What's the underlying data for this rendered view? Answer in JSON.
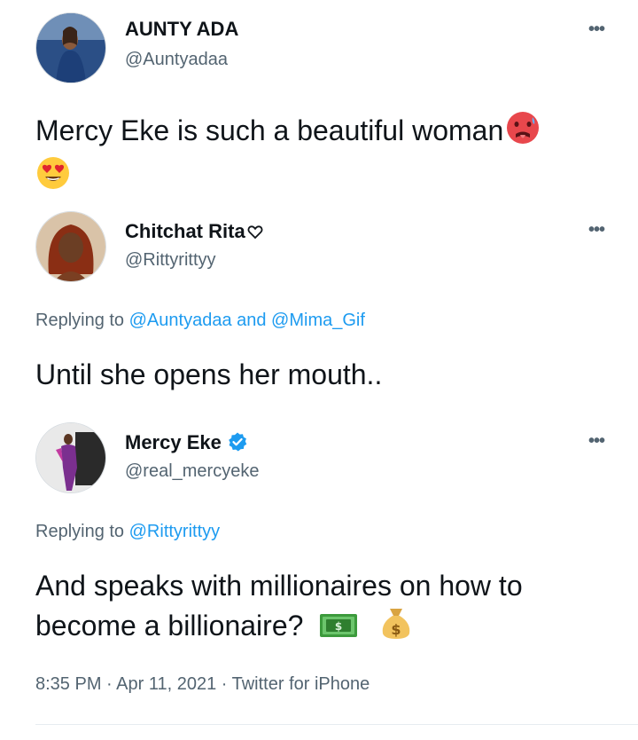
{
  "tweets": [
    {
      "name": "AUNTY ADA",
      "handle": "@Auntyadaa",
      "more": "•••",
      "text": "Mercy Eke is such a beautiful woman",
      "emojis": [
        "hot-face-emoji",
        "heart-eyes-emoji"
      ],
      "avatar_colors": [
        "#1a3a6b",
        "#3b6fae"
      ]
    },
    {
      "name": "Chitchat Rita",
      "handle": "@Rittyrittyy",
      "more": "•••",
      "reply_prefix": "Replying to ",
      "reply_mention_1": "@Auntyadaa",
      "reply_and": " and ",
      "reply_mention_2": "@Mima_Gif",
      "text": "Until she opens her mouth..",
      "avatar_colors": [
        "#5a2a18",
        "#b9562e"
      ]
    },
    {
      "name": "Mercy Eke",
      "handle": "@real_mercyeke",
      "more": "•••",
      "verified": true,
      "reply_prefix": "Replying to ",
      "reply_mention_1": "@Rittyrittyy",
      "text_line1": "And speaks with millionaires on how to",
      "text_line2": "become a billionaire?",
      "emojis": [
        "money-bill-emoji",
        "money-bag-emoji"
      ],
      "avatar_colors": [
        "#1c1c1c",
        "#6b2a7a"
      ]
    }
  ],
  "meta": {
    "time": "8:35 PM",
    "separator": " · ",
    "date": "Apr 11, 2021",
    "source": "Twitter for iPhone"
  },
  "colors": {
    "text": "#0f1419",
    "secondary": "#536471",
    "link": "#1d9bf0",
    "verified": "#1d9bf0"
  }
}
